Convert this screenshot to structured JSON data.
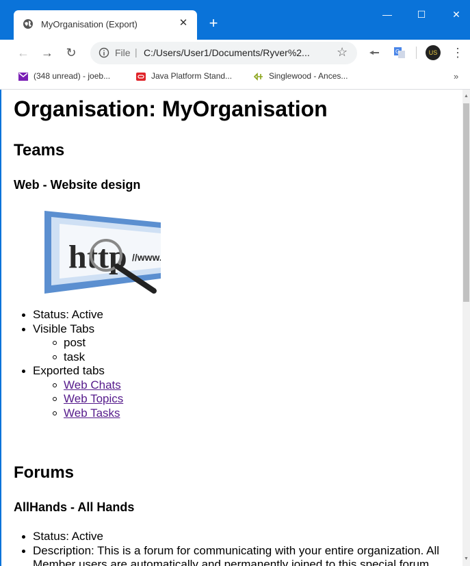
{
  "browser": {
    "tab_title": "MyOrganisation (Export)",
    "new_tab_label": "+",
    "omnibox_scheme": "File",
    "omnibox_url": "C:/Users/User1/Documents/Ryver%2...",
    "bookmarks": [
      {
        "label": "(348 unread) - joeb...",
        "icon": "mail-icon",
        "color": "#7a1fb5"
      },
      {
        "label": "Java Platform Stand...",
        "icon": "oracle-icon",
        "color": "#e0242a"
      },
      {
        "label": "Singlewood - Ances...",
        "icon": "ancestry-icon",
        "color": "#8aa41a"
      }
    ],
    "bookmarks_more": "»",
    "profile_initials": "US"
  },
  "page": {
    "title": "Organisation: MyOrganisation",
    "teams_heading": "Teams",
    "team": {
      "name": "Web - Website design",
      "status": "Status: Active",
      "visible_tabs_label": "Visible Tabs",
      "visible_tabs": [
        "post",
        "task"
      ],
      "exported_tabs_label": "Exported tabs",
      "exported_tabs": [
        "Web Chats",
        "Web Topics",
        "Web Tasks"
      ]
    },
    "forums_heading": "Forums",
    "forum": {
      "name": "AllHands - All Hands",
      "status": "Status: Active",
      "description": "Description: This is a forum for communicating with your entire organization. All Member users are automatically and permanently joined to this special forum."
    }
  },
  "colors": {
    "chrome_blue": "#0a73d9",
    "visited_link": "#551a8b"
  }
}
